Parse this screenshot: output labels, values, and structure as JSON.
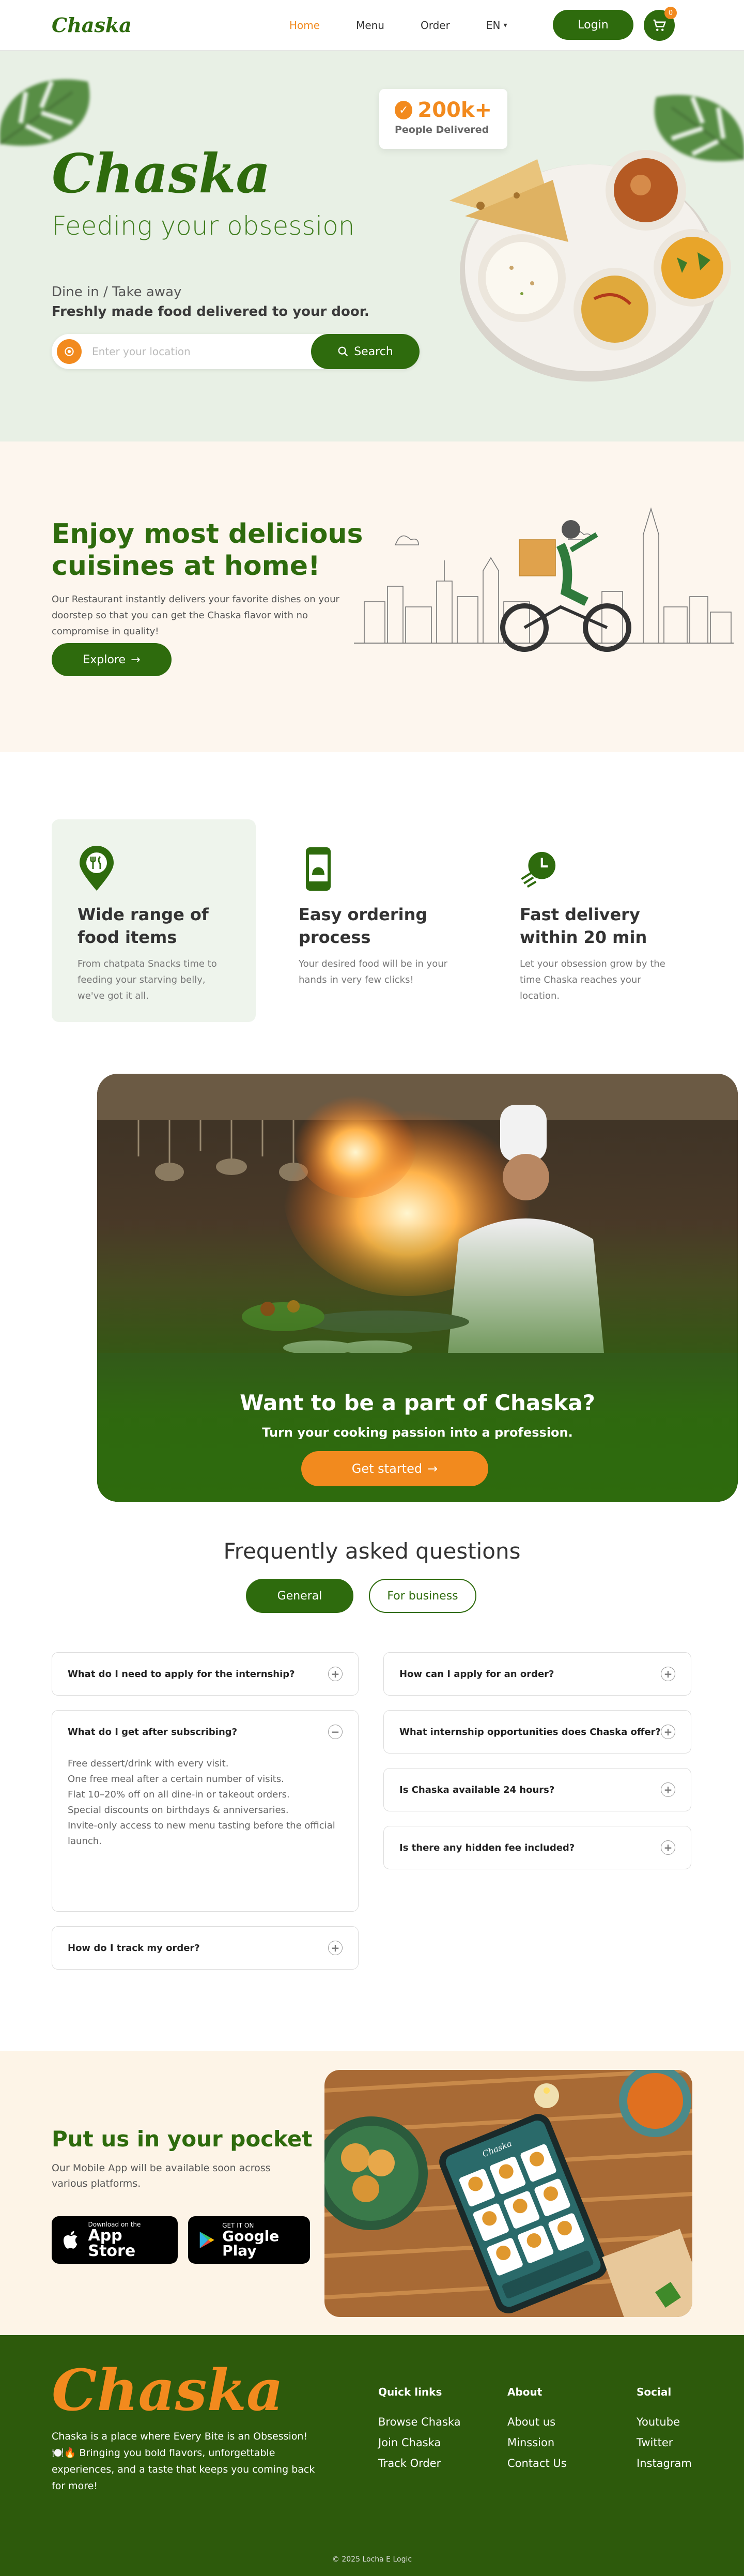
{
  "nav": {
    "logo": "Chaska",
    "links": [
      "Home",
      "Menu",
      "Order"
    ],
    "lang": "EN",
    "login": "Login",
    "cart_count": "0"
  },
  "hero": {
    "title": "Chaska",
    "tagline": "Feeding your obsession",
    "sub1": "Dine in / Take away",
    "sub2": "Freshly made food delivered to your door.",
    "search_placeholder": "Enter your location",
    "search_btn": "Search",
    "stat_value": "200k+",
    "stat_label": "People Delivered"
  },
  "cuisine": {
    "title": "Enjoy most delicious cuisines at home!",
    "body": "Our Restaurant instantly delivers your favorite dishes on your doorstep so that you can get the Chaska flavor with no compromise in quality!",
    "button": "Explore"
  },
  "features": [
    {
      "title": "Wide range of food items",
      "body": "From chatpata Snacks time to feeding your starving belly, we've got it all."
    },
    {
      "title": "Easy ordering process",
      "body": "Your desired food will be in your hands in very few clicks!"
    },
    {
      "title": "Fast delivery within 20 min",
      "body": "Let your obsession grow by the time Chaska reaches your location."
    }
  ],
  "career": {
    "title": "Want to be a part of Chaska?",
    "subtitle": "Turn your cooking passion into a profession.",
    "button": "Get started"
  },
  "faq": {
    "title": "Frequently asked questions",
    "tabs": [
      "General",
      "For business"
    ],
    "left": [
      {
        "q": "What do I need to apply for the internship?"
      },
      {
        "q": "What do I get after subscribing?",
        "a": [
          "Free dessert/drink with every visit.",
          "One free meal after a certain number of visits.",
          "Flat 10–20% off on all dine-in or takeout orders.",
          "Special discounts on birthdays & anniversaries.",
          "Invite-only access to new menu tasting before the official launch."
        ]
      },
      {
        "q": "How do I track my order?"
      }
    ],
    "right": [
      {
        "q": "How can I apply for an order?"
      },
      {
        "q": "What internship opportunities does Chaska offer?"
      },
      {
        "q": "Is Chaska available 24 hours?"
      },
      {
        "q": "Is there any hidden fee included?"
      }
    ]
  },
  "app": {
    "title": "Put us in your pocket",
    "body": "Our Mobile App will be available soon across various platforms.",
    "appstore_small": "Download on the",
    "appstore_big": "App Store",
    "play_small": "GET IT ON",
    "play_big": "Google Play",
    "phone_brand": "Chaska"
  },
  "footer": {
    "logo": "Chaska",
    "desc": "Chaska is a place where Every Bite is an Obsession! 🍽️🔥 Bringing you bold flavors, unforgettable experiences, and a taste that keeps you coming back for more!",
    "cols": [
      {
        "title": "Quick links",
        "items": [
          "Browse Chaska",
          "Join Chaska",
          "Track Order"
        ]
      },
      {
        "title": "About",
        "items": [
          "About us",
          "Minssion",
          "Contact Us"
        ]
      },
      {
        "title": "Social",
        "items": [
          "Youtube",
          "Twitter",
          "Instagram"
        ]
      }
    ],
    "copyright": "© 2025 Locha E Logic"
  },
  "colors": {
    "green": "#2e6b0d",
    "orange": "#f28a1e",
    "hero_bg": "#e8f0e5",
    "cream": "#fdf6ee",
    "footer": "#2d5a0c"
  }
}
